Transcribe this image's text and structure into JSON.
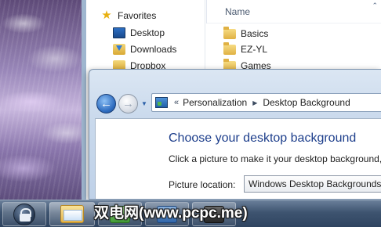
{
  "explorer": {
    "favorites_label": "Favorites",
    "nav_items": [
      {
        "label": "Desktop",
        "icon": "desktop-icon"
      },
      {
        "label": "Downloads",
        "icon": "downloads-icon"
      },
      {
        "label": "Dropbox",
        "icon": "dropbox-icon"
      }
    ],
    "column_header": "Name",
    "files": [
      "Basics",
      "EZ-YL",
      "Games"
    ]
  },
  "control_panel": {
    "breadcrumb_chevrons": "«",
    "breadcrumb": [
      "Personalization",
      "Desktop Background"
    ],
    "heading": "Choose your desktop background",
    "description": "Click a picture to make it your desktop background,",
    "picture_location_label": "Picture location:",
    "picture_location_value": "Windows Desktop Backgrounds"
  },
  "watermark": "双电网(www.pcpc.me)",
  "colors": {
    "heading_blue": "#1e3f8c",
    "taskbar": "#3e5470",
    "wallpaper_lilac": "#c7b6dd"
  }
}
